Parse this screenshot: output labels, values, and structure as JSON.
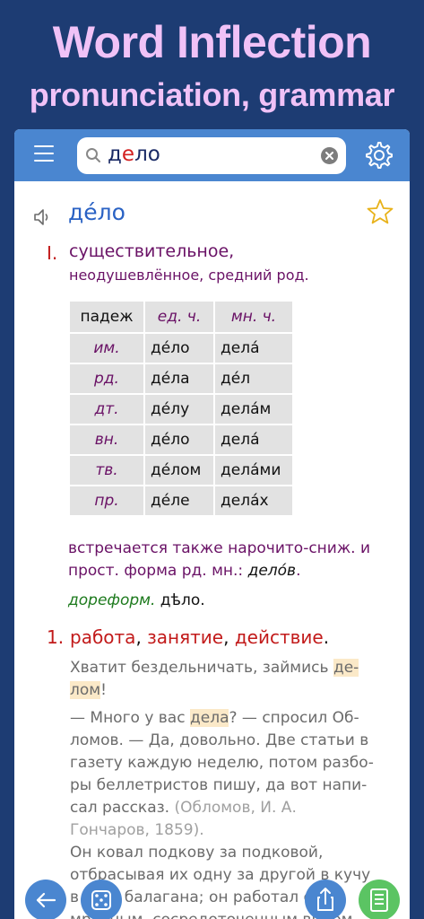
{
  "promo": {
    "title": "Word Inflection",
    "subtitle": "pronunciation, grammar"
  },
  "search": {
    "query_pre": "д",
    "query_accent": "е",
    "query_post": "ло"
  },
  "entry": {
    "headword": "де́ло",
    "roman_numeral": "I.",
    "pos_line1": "существительное,",
    "pos_line2": "неодушевлённое, средний род.",
    "table": {
      "headers": [
        "падеж",
        "ед. ч.",
        "мн. ч."
      ],
      "rows": [
        [
          "им.",
          "де́ло",
          "дела́"
        ],
        [
          "рд.",
          "де́ла",
          "де́л"
        ],
        [
          "дт.",
          "де́лу",
          "дела́м"
        ],
        [
          "вн.",
          "де́ло",
          "дела́"
        ],
        [
          "тв.",
          "де́лом",
          "дела́ми"
        ],
        [
          "пр.",
          "де́ле",
          "дела́х"
        ]
      ]
    },
    "note_text": "встречается также нарочито-сниж. и прост. форма рд. мн.: ",
    "note_form": "дело́в",
    "note_end": ".",
    "prereform_label": "дореформ.",
    "prereform_word": " дѣло."
  },
  "sense": {
    "number": "1.",
    "def1": "работа",
    "sep1": ", ",
    "def2": "занятие",
    "sep2": ", ",
    "def3": "действие",
    "end": ".",
    "examples": {
      "ex1_a": "Хватит бездельничать, займись ",
      "ex1_hl1": "де-",
      "ex1_hl2": "лом",
      "ex1_b": "!",
      "ex2_a": "— Много у вас ",
      "ex2_hl": "дела",
      "ex2_b": "? — спросил Об­ломов. — Да, довольно. Две статьи в газету каждую неделю, потом разбо­ры беллетристов пишу, да вот напи­сал рассказ. ",
      "ex2_src": "(Обломов, И. А. Гончаров, 1859).",
      "ex3": "Он ковал подкову за подковой, отбра­сывая их одну за другой в кучу в углу балагана; он работал с мрачным, со­средоточенным видом, сильно стре"
    }
  }
}
